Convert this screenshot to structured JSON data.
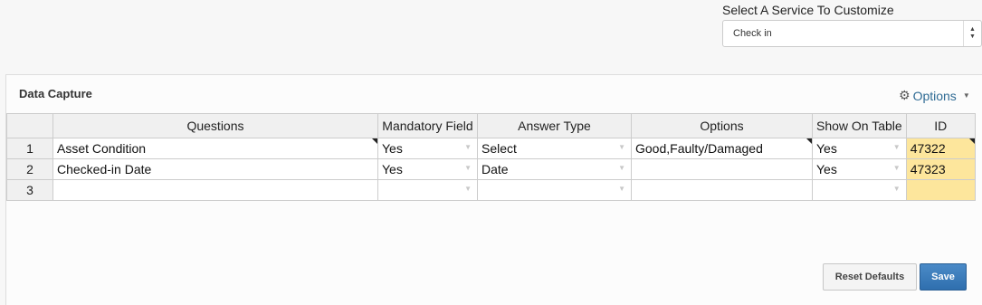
{
  "service": {
    "label": "Select A Service To Customize",
    "selected": "Check in"
  },
  "panel": {
    "title": "Data Capture",
    "options_label": "Options"
  },
  "grid": {
    "headers": [
      "Questions",
      "Mandatory Field",
      "Answer Type",
      "Options",
      "Show On Table",
      "ID"
    ],
    "rows": [
      {
        "num": "1",
        "question": "Asset Condition",
        "mandatory": "Yes",
        "answer_type": "Select",
        "options": "Good,Faulty/Damaged",
        "show_on_table": "Yes",
        "id": "47322"
      },
      {
        "num": "2",
        "question": "Checked-in Date",
        "mandatory": "Yes",
        "answer_type": "Date",
        "options": "",
        "show_on_table": "Yes",
        "id": "47323"
      },
      {
        "num": "3",
        "question": "",
        "mandatory": "",
        "answer_type": "",
        "options": "",
        "show_on_table": "",
        "id": ""
      }
    ]
  },
  "buttons": {
    "reset": "Reset Defaults",
    "save": "Save"
  },
  "colors": {
    "id_cell": "#fde69c",
    "save_button": "#3a7cbc",
    "options_link": "#2f6b94"
  },
  "icons": {
    "options": "gear-icon",
    "options_caret": "caret-down-icon",
    "select_arrows": "up-down-arrows-icon",
    "cell_dropdown": "dropdown-arrow-icon",
    "comment_marker": "cell-corner-marker-icon"
  }
}
